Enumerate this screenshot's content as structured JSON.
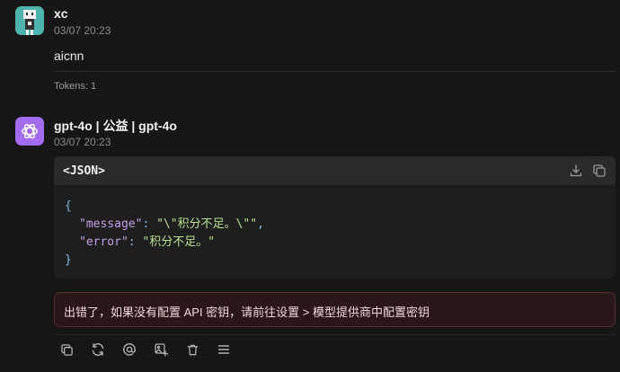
{
  "user_message": {
    "name": "xc",
    "time": "03/07 20:23",
    "text": "aicnn",
    "tokens": "Tokens: 1"
  },
  "bot_message": {
    "name": "gpt-4o | 公益 | gpt-4o",
    "time": "03/07 20:23",
    "code_lang": "<JSON>",
    "code": {
      "open": "{",
      "message_key": "\"message\"",
      "message_value": "\"\\\"积分不足。\\\"\"",
      "error_key": "\"error\"",
      "error_value": "\"积分不足。\"",
      "close": "}"
    },
    "error_text": "出错了，如果没有配置 API 密钥，请前往设置 > 模型提供商中配置密钥"
  },
  "icons": {
    "user_avatar": "robot-avatar-icon",
    "bot_avatar": "openai-logo-icon",
    "code_actions": [
      "download-icon",
      "copy-icon"
    ],
    "message_actions": [
      "copy-icon",
      "refresh-icon",
      "at-icon",
      "image-add-icon",
      "trash-icon",
      "menu-icon"
    ]
  },
  "colors": {
    "background": "#161616",
    "bot_avatar": "#a36cf0",
    "user_avatar": "#4fb3ad",
    "error_bg": "#2a1719",
    "error_border": "#5a2a2e"
  }
}
